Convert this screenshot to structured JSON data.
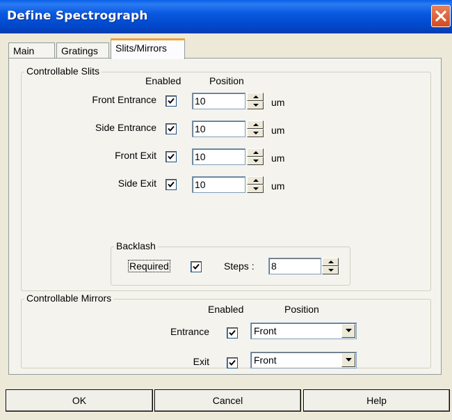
{
  "window": {
    "title": "Define Spectrograph"
  },
  "tabs": [
    "Main",
    "Gratings",
    "Slits/Mirrors"
  ],
  "slits": {
    "group_label": "Controllable Slits",
    "col_enabled": "Enabled",
    "col_position": "Position",
    "unit": "um",
    "rows": [
      {
        "label": "Front Entrance",
        "enabled": true,
        "value": "10"
      },
      {
        "label": "Side Entrance",
        "enabled": true,
        "value": "10"
      },
      {
        "label": "Front Exit",
        "enabled": true,
        "value": "10"
      },
      {
        "label": "Side Exit",
        "enabled": true,
        "value": "10"
      }
    ]
  },
  "backlash": {
    "group_label": "Backlash",
    "required_label": "Required",
    "required": true,
    "steps_label": "Steps :",
    "steps_value": "8"
  },
  "mirrors": {
    "group_label": "Controllable Mirrors",
    "col_enabled": "Enabled",
    "col_position": "Position",
    "rows": [
      {
        "label": "Entrance",
        "enabled": true,
        "value": "Front"
      },
      {
        "label": "Exit",
        "enabled": true,
        "value": "Front"
      }
    ]
  },
  "buttons": {
    "ok": "OK",
    "cancel": "Cancel",
    "help": "Help"
  },
  "icons": {
    "close": "close-icon",
    "check": "checkmark-icon",
    "up": "spin-up-icon",
    "down": "spin-down-icon",
    "dropdown": "dropdown-arrow-icon"
  },
  "colors": {
    "titlebar": "#0a58e0",
    "close_button": "#d14b22",
    "tab_highlight": "#e8a33c",
    "dialog_bg": "#ece9d8"
  }
}
